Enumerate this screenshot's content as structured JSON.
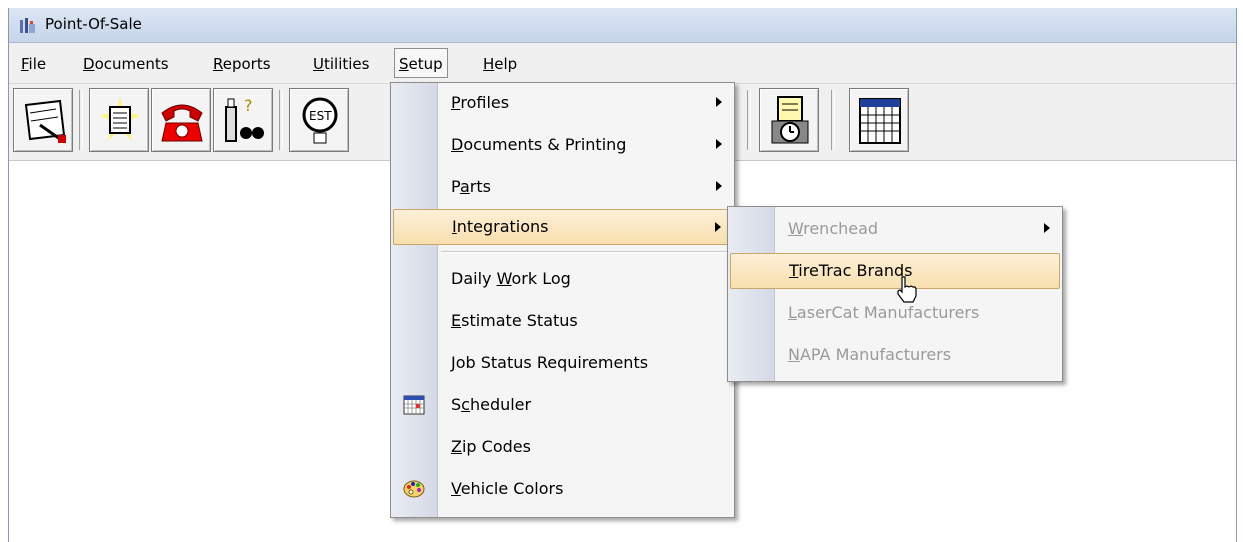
{
  "window": {
    "title": "Point-Of-Sale"
  },
  "menubar": {
    "items": [
      {
        "label": "File",
        "access": "F",
        "rest": "ile"
      },
      {
        "label": "Documents",
        "access": "D",
        "rest": "ocuments"
      },
      {
        "label": "Reports",
        "access": "R",
        "rest": "eports"
      },
      {
        "label": "Utilities",
        "access": "U",
        "rest": "tilities"
      },
      {
        "label": "Setup",
        "access": "S",
        "rest": "etup"
      },
      {
        "label": "Help",
        "access": "H",
        "rest": "elp"
      }
    ]
  },
  "setup_menu": {
    "items": [
      {
        "pre": "",
        "access": "P",
        "rest": "rofiles",
        "submenu": true
      },
      {
        "pre": "",
        "access": "D",
        "rest": "ocuments & Printing",
        "submenu": true
      },
      {
        "pre": "P",
        "access": "a",
        "rest": "rts",
        "submenu": true
      },
      {
        "pre": "",
        "access": "I",
        "rest": "ntegrations",
        "submenu": true
      },
      {
        "pre": "Daily ",
        "access": "W",
        "rest": "ork Log"
      },
      {
        "pre": "",
        "access": "E",
        "rest": "stimate Status"
      },
      {
        "pre": "",
        "access": "J",
        "rest": "ob Status Requirements"
      },
      {
        "pre": "S",
        "access": "c",
        "rest": "heduler",
        "icon": "calendar-icon"
      },
      {
        "pre": "",
        "access": "Z",
        "rest": "ip Codes"
      },
      {
        "pre": "",
        "access": "V",
        "rest": "ehicle Colors",
        "icon": "palette-icon"
      }
    ]
  },
  "integrations_menu": {
    "items": [
      {
        "pre": "",
        "access": "W",
        "rest": "renchead",
        "disabled": true,
        "submenu": true
      },
      {
        "pre": "",
        "access": "T",
        "rest": "ireTrac Brands",
        "disabled": false
      },
      {
        "pre": "",
        "access": "L",
        "rest": "aserCat Manufacturers",
        "disabled": true
      },
      {
        "pre": "",
        "access": "N",
        "rest": "APA Manufacturers",
        "disabled": true
      }
    ]
  },
  "colors": {
    "highlight": "#f7dfae",
    "disabled_text": "#9a9a9a",
    "menu_bg": "#f5f5f5"
  }
}
